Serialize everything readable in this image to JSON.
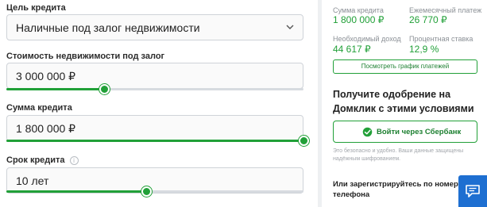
{
  "form": {
    "purpose_label": "Цель кредита",
    "purpose_value": "Наличные под залог недвижимости",
    "property_label": "Стоимость недвижимости под залог",
    "property_value": "3 000 000 ₽",
    "property_slider_fraction": 0.33,
    "amount_label": "Сумма кредита",
    "amount_value": "1 800 000 ₽",
    "amount_slider_fraction": 1.0,
    "term_label": "Срок кредита",
    "term_info_glyph": "i",
    "term_value": "10 лет",
    "term_slider_fraction": 0.47
  },
  "summary": {
    "loan_sum_label": "Сумма кредита",
    "loan_sum_value": "1 800 000 ₽",
    "monthly_label": "Ежемесячный платеж",
    "monthly_value": "26 770 ₽",
    "income_label": "Необходимый доход",
    "income_value": "44 617 ₽",
    "rate_label": "Процентная ставка",
    "rate_value": "12,9 %",
    "schedule_button": "Посмотреть график платежей",
    "approval_title": "Получите одобрение на Домклик с этими условиями",
    "sber_button": "Войти через Сбербанк",
    "note": "Это безопасно и удобно. Ваши данные защищены надёжным шифрованием.",
    "register_text": "Или зарегистрируйтесь по номеру телефона"
  },
  "colors": {
    "accent": "#21a038",
    "chat_button": "#1e6fd1"
  },
  "icons": {
    "dropdown": "chevron-down-icon",
    "info": "info-icon",
    "sber": "sber-logo-icon",
    "chat": "chat-icon"
  }
}
